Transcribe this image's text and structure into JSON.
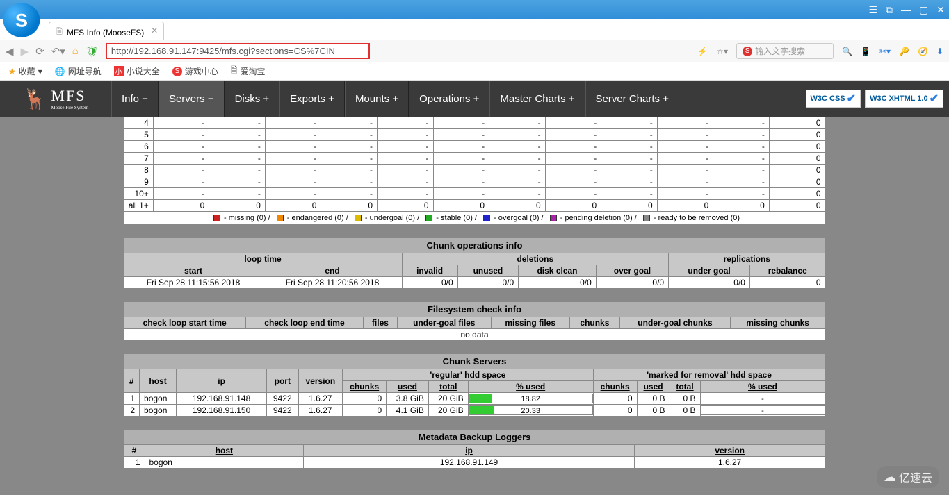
{
  "browser": {
    "tab_title": "MFS Info (MooseFS)",
    "url": "http://192.168.91.147:9425/mfs.cgi?sections=CS%7CIN",
    "search_placeholder": "输入文字搜索",
    "bookmarks": [
      "收藏",
      "网址导航",
      "小说大全",
      "游戏中心",
      "爱淘宝"
    ],
    "win_controls": [
      "☰",
      "⧉",
      "—",
      "▢",
      "✕"
    ]
  },
  "mfs": {
    "logo_big": "MFS",
    "logo_small": "Moose File System",
    "nav": [
      {
        "label": "Info −"
      },
      {
        "label": "Servers −",
        "active": true
      },
      {
        "label": "Disks +"
      },
      {
        "label": "Exports +"
      },
      {
        "label": "Mounts +"
      },
      {
        "label": "Operations +"
      },
      {
        "label": "Master Charts +"
      },
      {
        "label": "Server Charts +"
      }
    ],
    "badge_css": "W3C CSS",
    "badge_xhtml": "W3C XHTML 1.0"
  },
  "goal_table": {
    "rows": [
      {
        "g": "4",
        "c": [
          "-",
          "-",
          "-",
          "-",
          "-",
          "-",
          "-",
          "-",
          "-",
          "-",
          "-",
          "0"
        ]
      },
      {
        "g": "5",
        "c": [
          "-",
          "-",
          "-",
          "-",
          "-",
          "-",
          "-",
          "-",
          "-",
          "-",
          "-",
          "0"
        ]
      },
      {
        "g": "6",
        "c": [
          "-",
          "-",
          "-",
          "-",
          "-",
          "-",
          "-",
          "-",
          "-",
          "-",
          "-",
          "0"
        ]
      },
      {
        "g": "7",
        "c": [
          "-",
          "-",
          "-",
          "-",
          "-",
          "-",
          "-",
          "-",
          "-",
          "-",
          "-",
          "0"
        ]
      },
      {
        "g": "8",
        "c": [
          "-",
          "-",
          "-",
          "-",
          "-",
          "-",
          "-",
          "-",
          "-",
          "-",
          "-",
          "0"
        ]
      },
      {
        "g": "9",
        "c": [
          "-",
          "-",
          "-",
          "-",
          "-",
          "-",
          "-",
          "-",
          "-",
          "-",
          "-",
          "0"
        ]
      },
      {
        "g": "10+",
        "c": [
          "-",
          "-",
          "-",
          "-",
          "-",
          "-",
          "-",
          "-",
          "-",
          "-",
          "-",
          "0"
        ]
      },
      {
        "g": "all 1+",
        "c": [
          "0",
          "0",
          "0",
          "0",
          "0",
          "0",
          "0",
          "0",
          "0",
          "0",
          "0",
          "0"
        ]
      }
    ],
    "legend": [
      {
        "color": "#cc2222",
        "label": "missing (0)"
      },
      {
        "color": "#ee8800",
        "label": "endangered (0)"
      },
      {
        "color": "#ddbb00",
        "label": "undergoal (0)"
      },
      {
        "color": "#22aa22",
        "label": "stable (0)"
      },
      {
        "color": "#2222cc",
        "label": "overgoal (0)"
      },
      {
        "color": "#aa22aa",
        "label": "pending deletion (0)"
      },
      {
        "color": "#888888",
        "label": "ready to be removed (0)"
      }
    ]
  },
  "chunk_ops": {
    "title": "Chunk operations info",
    "h_loop": "loop time",
    "h_del": "deletions",
    "h_rep": "replications",
    "h_start": "start",
    "h_end": "end",
    "h_inv": "invalid",
    "h_unu": "unused",
    "h_dc": "disk clean",
    "h_og": "over goal",
    "h_ug": "under goal",
    "h_rb": "rebalance",
    "row": {
      "start": "Fri Sep 28 11:15:56 2018",
      "end": "Fri Sep 28 11:20:56 2018",
      "inv": "0/0",
      "unu": "0/0",
      "dc": "0/0",
      "og": "0/0",
      "ug": "0/0",
      "rb": "0"
    }
  },
  "fs_check": {
    "title": "Filesystem check info",
    "headers": [
      "check loop start time",
      "check loop end time",
      "files",
      "under-goal files",
      "missing files",
      "chunks",
      "under-goal chunks",
      "missing chunks"
    ],
    "nodata": "no data"
  },
  "chunk_servers": {
    "title": "Chunk Servers",
    "h_num": "#",
    "h_host": "host",
    "h_ip": "ip",
    "h_port": "port",
    "h_ver": "version",
    "h_reg": "'regular' hdd space",
    "h_mfr": "'marked for removal' hdd space",
    "h_chunks": "chunks",
    "h_used": "used",
    "h_total": "total",
    "h_pused": "% used",
    "rows": [
      {
        "n": "1",
        "host": "bogon",
        "ip": "192.168.91.148",
        "port": "9422",
        "ver": "1.6.27",
        "rc": "0",
        "ru": "3.8 GiB",
        "rt": "20 GiB",
        "rpv": 18.82,
        "rp": "18.82",
        "mc": "0",
        "mu": "0 B",
        "mt": "0 B",
        "mp": "-"
      },
      {
        "n": "2",
        "host": "bogon",
        "ip": "192.168.91.150",
        "port": "9422",
        "ver": "1.6.27",
        "rc": "0",
        "ru": "4.1 GiB",
        "rt": "20 GiB",
        "rpv": 20.33,
        "rp": "20.33",
        "mc": "0",
        "mu": "0 B",
        "mt": "0 B",
        "mp": "-"
      }
    ]
  },
  "loggers": {
    "title": "Metadata Backup Loggers",
    "h_num": "#",
    "h_host": "host",
    "h_ip": "ip",
    "h_ver": "version",
    "rows": [
      {
        "n": "1",
        "host": "bogon",
        "ip": "192.168.91.149",
        "ver": "1.6.27"
      }
    ]
  },
  "watermark": "亿速云"
}
